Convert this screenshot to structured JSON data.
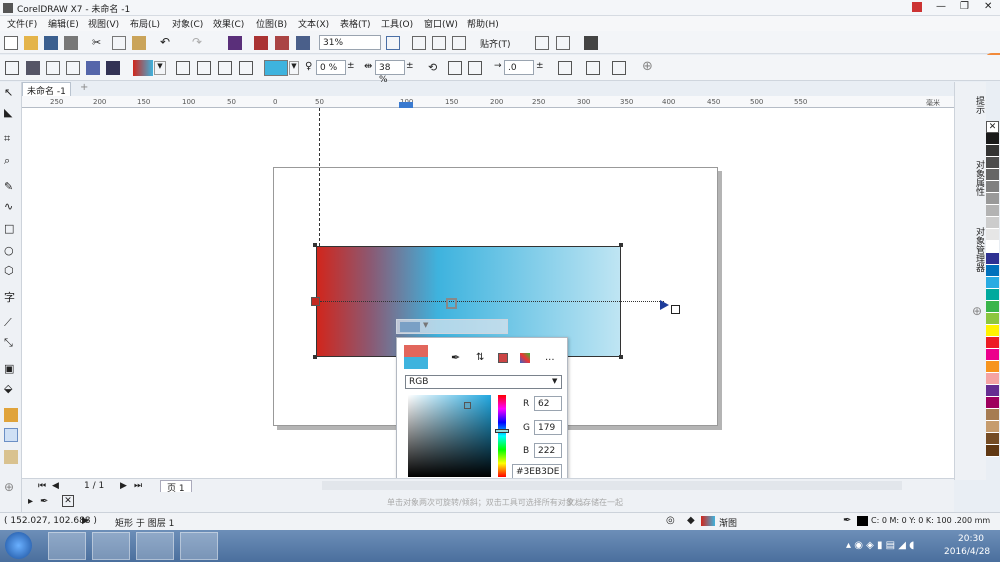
{
  "title": "CorelDRAW X7 - 未命名 -1",
  "menu": [
    "文件(F)",
    "编辑(E)",
    "视图(V)",
    "布局(L)",
    "对象(C)",
    "效果(C)",
    "位图(B)",
    "文本(X)",
    "表格(T)",
    "工具(O)",
    "窗口(W)",
    "帮助(H)"
  ],
  "toolbar": {
    "zoom": "31%",
    "snap": "贴齐(T)"
  },
  "propbar": {
    "opacity": "0 %",
    "midpoint": "38 %",
    "offset": ".0"
  },
  "doc_tab": "未命名 -1",
  "ruler_top": [
    "250",
    "200",
    "150",
    "100",
    "50",
    "0",
    "50",
    "100",
    "150",
    "200",
    "250",
    "300",
    "350",
    "400",
    "450",
    "500",
    "550"
  ],
  "ruler_unit": "毫米",
  "page_nav": {
    "count": "1 / 1",
    "page": "页 1"
  },
  "popup": {
    "mode": "RGB",
    "r": "62",
    "g": "179",
    "b": "222",
    "r_label": "R",
    "g_label": "G",
    "b_label": "B",
    "hex": "#3EB3DE",
    "more": "..."
  },
  "docker": [
    "提示",
    "对象属性",
    "对象管理器"
  ],
  "status": {
    "coords": "( 152.027, 102.688 )",
    "info": "矩形 于 图层 1",
    "fill": "渐图",
    "outline": "C: 0 M: 0 Y: 0 K: 100 .200 mm",
    "hint": "单击对象两次可旋转/倾斜；双击工具可选择所有对象……",
    "hint2": "文档存储在一起"
  },
  "clock": {
    "time": "20:30",
    "date": "2016/4/28"
  },
  "palette": [
    "#1a1a1a",
    "#333333",
    "#4d4d4d",
    "#666666",
    "#808080",
    "#999999",
    "#b3b3b3",
    "#cccccc",
    "#e6e6e6",
    "#ffffff",
    "#2e3192",
    "#0071bc",
    "#29abe2",
    "#00a99d",
    "#39b54a",
    "#8cc63f",
    "#fff200",
    "#ed1c24",
    "#ec008c",
    "#f7941d",
    "#f5a3a3",
    "#662d91",
    "#9e005d",
    "#a67c52",
    "#c69c6d",
    "#754c24",
    "#603813"
  ],
  "colors": {
    "grad_start": "#d1261c",
    "grad_mid": "#3eb3de",
    "grad_end": "#bfe5f3"
  }
}
